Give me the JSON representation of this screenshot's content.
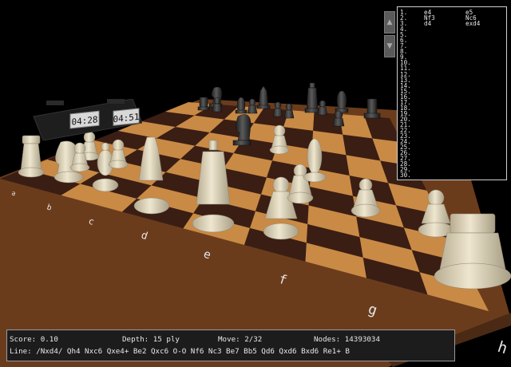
{
  "status": {
    "score": "Score: 0.10",
    "depth": "Depth: 15 ply",
    "move": "Move: 2/32",
    "nodes": "Nodes: 14393034",
    "line": "Line: /Nxd4/ Qh4 Nxc6 Qxe4+ Be2 Qxc6 O-O Nf6 Nc3 Be7 Bb5 Qd6 Qxd6 Bxd6 Re1+ B"
  },
  "clock": {
    "left": "04:28",
    "right": "04:51"
  },
  "movelist": {
    "rows": [
      {
        "num": "1.",
        "white": "e4",
        "black": "e5"
      },
      {
        "num": "2.",
        "white": "Nf3",
        "black": "Nc6"
      },
      {
        "num": "3.",
        "white": "d4",
        "black": "exd4"
      },
      {
        "num": "4.",
        "white": "",
        "black": ""
      },
      {
        "num": "5.",
        "white": "",
        "black": ""
      },
      {
        "num": "6.",
        "white": "",
        "black": ""
      },
      {
        "num": "7.",
        "white": "",
        "black": ""
      },
      {
        "num": "8.",
        "white": "",
        "black": ""
      },
      {
        "num": "9.",
        "white": "",
        "black": ""
      },
      {
        "num": "10.",
        "white": "",
        "black": ""
      },
      {
        "num": "11.",
        "white": "",
        "black": ""
      },
      {
        "num": "12.",
        "white": "",
        "black": ""
      },
      {
        "num": "13.",
        "white": "",
        "black": ""
      },
      {
        "num": "14.",
        "white": "",
        "black": ""
      },
      {
        "num": "15.",
        "white": "",
        "black": ""
      },
      {
        "num": "16.",
        "white": "",
        "black": ""
      },
      {
        "num": "17.",
        "white": "",
        "black": ""
      },
      {
        "num": "18.",
        "white": "",
        "black": ""
      },
      {
        "num": "19.",
        "white": "",
        "black": ""
      },
      {
        "num": "20.",
        "white": "",
        "black": ""
      },
      {
        "num": "21.",
        "white": "",
        "black": ""
      },
      {
        "num": "22.",
        "white": "",
        "black": ""
      },
      {
        "num": "23.",
        "white": "",
        "black": ""
      },
      {
        "num": "24.",
        "white": "",
        "black": ""
      },
      {
        "num": "25.",
        "white": "",
        "black": ""
      },
      {
        "num": "26.",
        "white": "",
        "black": ""
      },
      {
        "num": "27.",
        "white": "",
        "black": ""
      },
      {
        "num": "28.",
        "white": "",
        "black": ""
      },
      {
        "num": "29.",
        "white": "",
        "black": ""
      },
      {
        "num": "30.",
        "white": "",
        "black": ""
      }
    ]
  },
  "board": {
    "files": [
      "a",
      "b",
      "c",
      "d",
      "e",
      "f",
      "g",
      "h"
    ],
    "light_square": "#c98a45",
    "dark_square": "#3a1e14",
    "frame_color": "#7a4a22",
    "white_pieces": "#e6dcc2",
    "black_pieces": "#3c3c3c"
  },
  "scroll": {
    "up_icon": "scroll-up-arrow-icon",
    "down_icon": "scroll-down-arrow-icon"
  }
}
